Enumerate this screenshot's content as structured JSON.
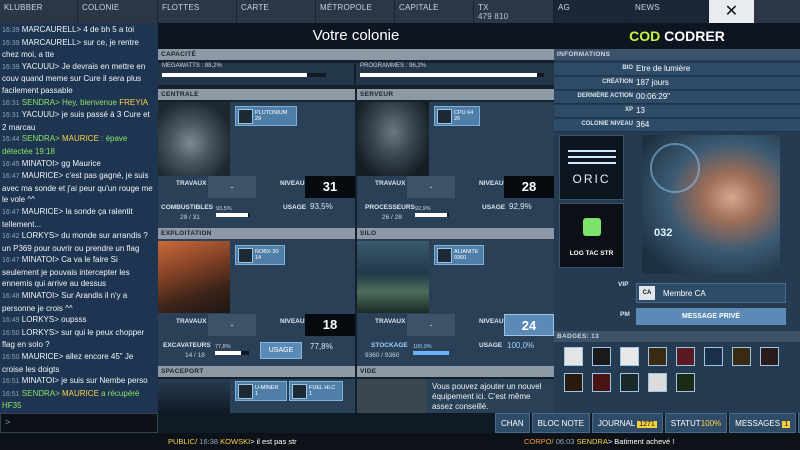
{
  "nav": {
    "klubber": "KLUBBER",
    "colonie": "COLONIE",
    "flottes": "FLOTTES",
    "carte": "CARTE",
    "metropole": "MÉTROPOLE",
    "capitale": "CAPITALE",
    "tx_label": "TX",
    "tx_value": "479 810",
    "ag": "AG",
    "news": "NEWS",
    "close": "✕"
  },
  "chat": [
    {
      "t": "16:39",
      "u": "MARCAURELL",
      "m": "> 4 de bh 5 a toi"
    },
    {
      "t": "16:39",
      "u": "MARCAURELL",
      "m": "> sur ce, je rentre chez moi, a tte"
    },
    {
      "t": "16:39",
      "u": "YACUUU",
      "m": "> Je devrais en mettre en couv quand meme sur Cure il sera plus facilement passable"
    },
    {
      "t": "16:31",
      "u": "SENDRA",
      "m": "> Hey, bienvenue ",
      "h": "FREYIA",
      "sys": true
    },
    {
      "t": "16:31",
      "u": "YACUUU",
      "m": "> je suis passé à 3 Cure et 2 marcau"
    },
    {
      "t": "16:44",
      "u": "SENDRA",
      "m": "> ",
      "h": "MAURICE",
      "x": " : épave détectée 19:18",
      "sys": true
    },
    {
      "t": "16:45",
      "u": "MINATOI",
      "m": "> gg Maurice"
    },
    {
      "t": "16:47",
      "u": "MAURICE",
      "m": "> c'est pas gagné, je suis avec ma sonde et j'ai peur qu'un rouge me le vole ^^"
    },
    {
      "t": "16:47",
      "u": "MAURICE",
      "m": "> la sonde ça ralentit tellement..."
    },
    {
      "t": "16:42",
      "u": "LORKYS",
      "m": "> du monde sur arrandis ? un P369 pour ouvrir ou prendre un flag"
    },
    {
      "t": "16:47",
      "u": "MINATOI",
      "m": "> Ca va le faire  Si seulement je pouvais intercepter les ennemis qui arrive au dessus"
    },
    {
      "t": "16:48",
      "u": "MINATOI",
      "m": "> Sur Arandis il n'y a personne je crois ^^"
    },
    {
      "t": "16:49",
      "u": "LORKYS",
      "m": "> oupsss"
    },
    {
      "t": "16:50",
      "u": "LORKYS",
      "m": "> sur qui le peux chopper flag en solo ?"
    },
    {
      "t": "16:50",
      "u": "MAURICE",
      "m": "> allez encore 45\" Je croise les doigts"
    },
    {
      "t": "16:51",
      "u": "MINATOI",
      "m": "> je suis sur Nembe perso"
    },
    {
      "t": "16:51",
      "u": "SENDRA",
      "m": "> ",
      "h": "MAURICE",
      "x": " a récupéré HF35",
      "sys": true
    },
    {
      "t": "16:51",
      "u": "SENDRA",
      "m": "> Alerte : crash de cargo",
      "sys": true
    },
    {
      "t": "16:53",
      "u": "SENDRA",
      "m": "> Alerte : crash de cargo",
      "sys": true
    }
  ],
  "chat_input": ">",
  "center": {
    "title": "Votre colonie",
    "capacite": "CAPACITÉ",
    "megawatts": "MEGAWATTS : 88,2%",
    "megawatts_pct": 88.2,
    "programmes": "PROGRAMMES : 96,2%",
    "programmes_pct": 96.2,
    "travaux": "TRAVAUX",
    "niveau": "NIVEAU",
    "usage": "USAGE",
    "dash": "-",
    "centrale": {
      "head": "CENTRALE",
      "chip": "PLUTONIUM",
      "chip_n": "29",
      "level": "31",
      "res_label": "COMBUSTIBLES",
      "res_val": "29 / 31",
      "mini": "93,5%",
      "mini_pct": 93.5,
      "usage": "93,5%"
    },
    "serveur": {
      "head": "SERVEUR",
      "chip": "CPU 64",
      "chip_n": "26",
      "level": "28",
      "res_label": "PROCESSEURS",
      "res_val": "26 / 28",
      "mini": "92,9%",
      "mini_pct": 92.9,
      "usage": "92,9%"
    },
    "exploitation": {
      "head": "EXPLOITATION",
      "chip": "ROBX-30",
      "chip_n": "14",
      "level": "18",
      "res_label": "EXCAVATEURS",
      "res_val": "14 / 18",
      "mini": "77,8%",
      "mini_pct": 77.8,
      "usage_btn": "USAGE",
      "usage": "77,8%"
    },
    "silo": {
      "head": "SILO",
      "chip": "ALIANITE",
      "chip_n": "9360",
      "level": "24",
      "res_label": "STOCKAGE",
      "res_val": "9360 / 9360",
      "mini": "100,0%",
      "mini_pct": 100,
      "usage": "100,0%"
    },
    "spaceport": {
      "head": "SPACEPORT",
      "chip1": "U-MINER",
      "chip1_n": "1",
      "chip2": "FUEL HLC",
      "chip2_n": "1"
    },
    "vide": {
      "head": "VIDE",
      "text": "Vous pouvez ajouter un nouvel équipement ici. C'est même assez conseillé."
    }
  },
  "right": {
    "title_tag": "COD",
    "title_name": "CODRER",
    "informations": "INFORMATIONS",
    "rows": [
      {
        "k": "BIO",
        "v": "Etre de lumière"
      },
      {
        "k": "CRÉATION",
        "v": "187 jours"
      },
      {
        "k": "DERNIÈRE ACTION",
        "v": "00:06:29\""
      },
      {
        "k": "XP",
        "v": "13"
      },
      {
        "k": "COLONIE NIVEAU",
        "v": "364"
      }
    ],
    "corp_logo": "ORIC",
    "corp2": "LOG TAC STR",
    "portrait_num": "032",
    "vip": "VIP",
    "membre": "Membre CA",
    "pm": "PM",
    "msg_prive": "MESSAGE PRIVÉ",
    "badges_label": "BADGES: 13",
    "badge_icons": [
      "file-icon",
      "ca-icon",
      "mail-icon",
      "warning-icon",
      "gem-icon",
      "target-icon",
      "person-icon",
      "skull-icon",
      "bullet-icon",
      "helmet-icon",
      "ship-icon",
      "ag-icon",
      "eye-icon"
    ]
  },
  "bottom": {
    "chan": "CHAN",
    "bloc": "BLOC NOTE",
    "journal": "JOURNAL",
    "journal_n": "1271",
    "statut": "STATUT",
    "statut_v": "100%",
    "messages": "MESSAGES",
    "messages_n": "1",
    "ag": "AG"
  },
  "footer": {
    "pub_tag": "PUBLIC/",
    "pub_time": "16:38",
    "pub_user": "KOWSKI",
    "pub_msg": "> il est pas str",
    "cor_tag": "CORPO/",
    "cor_time": "06:03",
    "cor_user": "SENDRA",
    "cor_msg": "> Batiment achevé !"
  }
}
